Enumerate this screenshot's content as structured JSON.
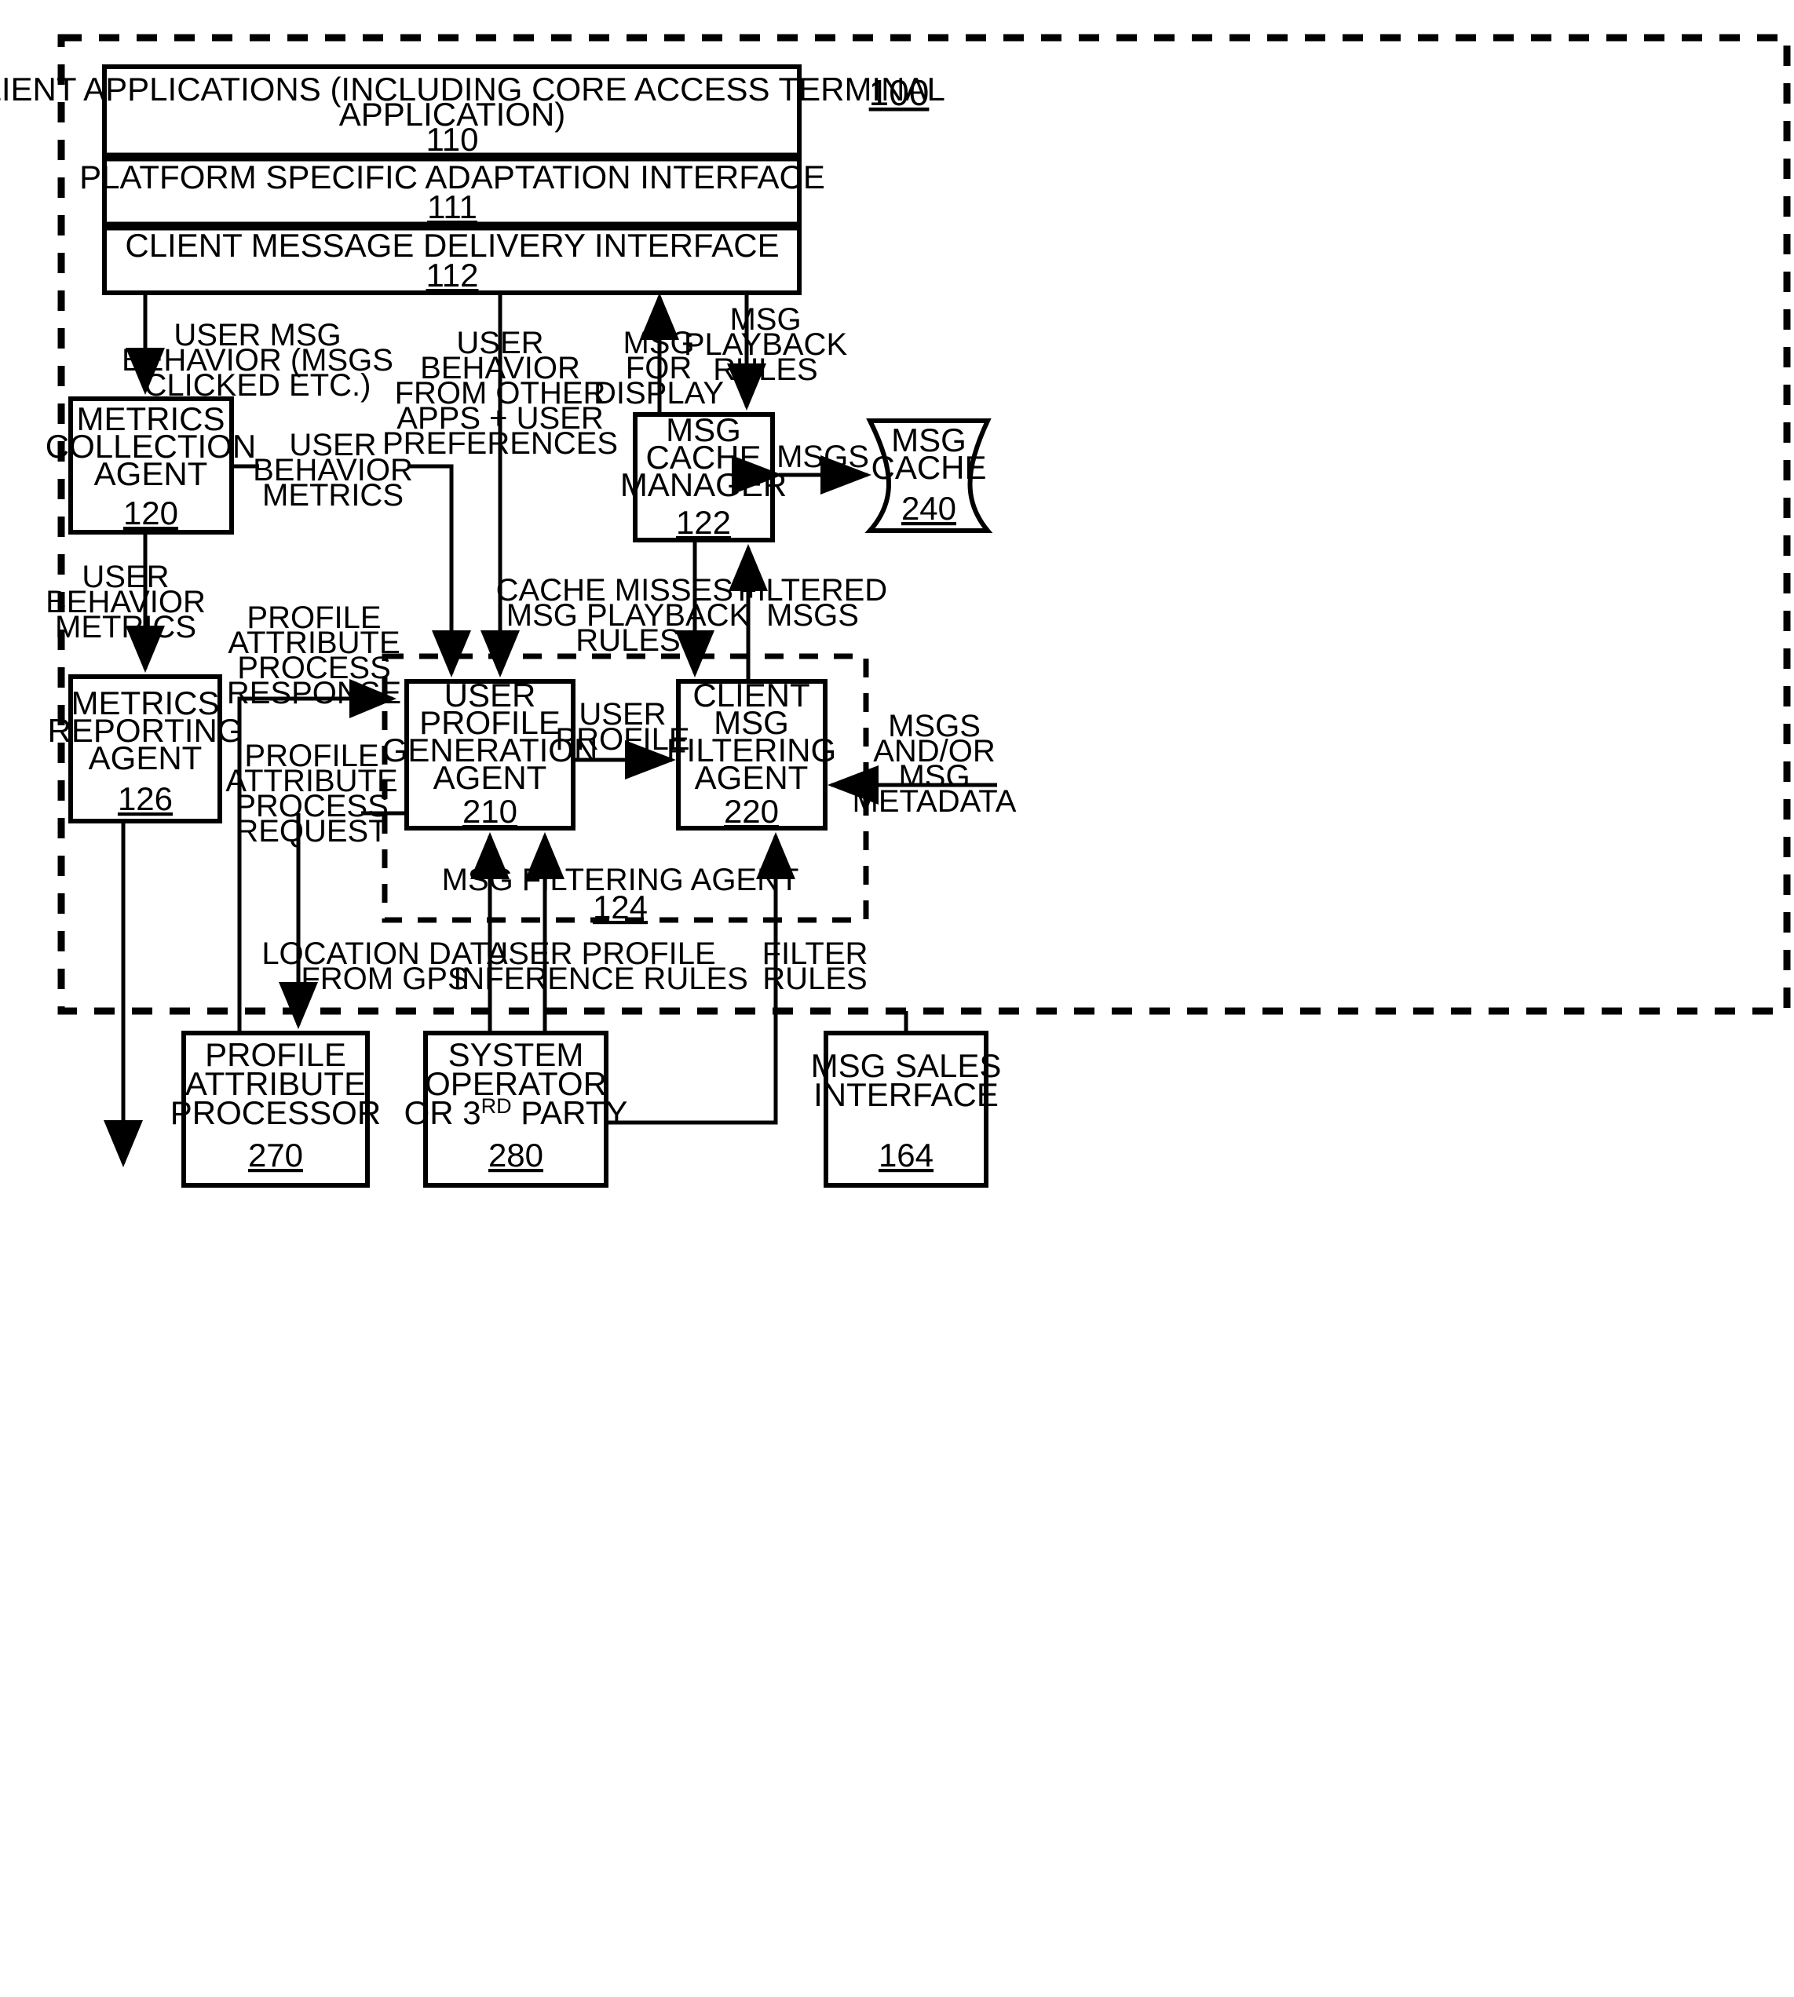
{
  "figure": {
    "reference_number": "100"
  },
  "stack": {
    "client_applications": {
      "line1": "CLIENT APPLICATIONS (INCLUDING CORE ACCESS TERMINAL",
      "line2": "APPLICATION)",
      "ref": "110"
    },
    "platform_interface": {
      "line1": "PLATFORM SPECIFIC ADAPTATION INTERFACE",
      "ref": "111"
    },
    "delivery_interface": {
      "line1": "CLIENT MESSAGE DELIVERY INTERFACE",
      "ref": "112"
    }
  },
  "boxes": {
    "metrics_collection_agent": {
      "lines": [
        "METRICS",
        "COLLECTION",
        "AGENT"
      ],
      "ref": "120"
    },
    "metrics_reporting_agent": {
      "lines": [
        "METRICS",
        "REPORTING",
        "AGENT"
      ],
      "ref": "126"
    },
    "msg_cache_manager": {
      "lines": [
        "MSG",
        "CACHE",
        "MANAGER"
      ],
      "ref": "122"
    },
    "msg_cache": {
      "lines": [
        "MSG",
        "CACHE"
      ],
      "ref": "240"
    },
    "user_profile_generation_agent": {
      "lines": [
        "USER",
        "PROFILE",
        "GENERATION",
        "AGENT"
      ],
      "ref": "210"
    },
    "client_msg_filtering_agent": {
      "lines": [
        "CLIENT",
        "MSG",
        "FILTERING",
        "AGENT"
      ],
      "ref": "220"
    },
    "msg_filtering_agent_group": {
      "label": "MSG FILTERING AGENT",
      "ref": "124"
    },
    "profile_attribute_processor": {
      "lines": [
        "PROFILE",
        "ATTRIBUTE",
        "PROCESSOR"
      ],
      "ref": "270"
    },
    "system_operator": {
      "line1": "SYSTEM",
      "line2": "OPERATOR",
      "line3_pre": "OR 3",
      "line3_sup": "RD",
      "line3_post": " PARTY",
      "ref": "280"
    },
    "msg_sales_interface": {
      "lines": [
        "MSG SALES",
        "INTERFACE"
      ],
      "ref": "164"
    }
  },
  "edge_labels": {
    "user_msg_behavior": [
      "USER MSG",
      "BEHAVIOR (MSGS",
      "CLICKED ETC.)"
    ],
    "user_behavior_other_apps": [
      "USER",
      "BEHAVIOR",
      "FROM OTHER",
      "APPS + USER",
      "PREFERENCES"
    ],
    "msg_for_display": [
      "MSG",
      "FOR",
      "DISPLAY"
    ],
    "msg_playback_rules": [
      "MSG",
      "PLAYBACK",
      "RULES"
    ],
    "user_behavior_metrics_right": [
      "USER",
      "BEHAVIOR",
      "METRICS"
    ],
    "msgs": [
      "MSGS"
    ],
    "user_behavior_metrics_down": [
      "USER",
      "BEHAVIOR",
      "METRICS"
    ],
    "profile_attribute_process_response": [
      "PROFILE",
      "ATTRIBUTE",
      "PROCESS",
      "RESPONSE"
    ],
    "profile_attribute_process_request": [
      "PROFILE",
      "ATTRIBUTE",
      "PROCESS",
      "REQUEST"
    ],
    "cache_misses": [
      "CACHE MISSES +",
      "MSG PLAYBACK",
      "RULES"
    ],
    "filtered_msgs": [
      "FILTERED",
      "MSGS"
    ],
    "user_profile": [
      "USER",
      "PROFILE"
    ],
    "msgs_andor_metadata": [
      "MSGS",
      "AND/OR",
      "MSG",
      "METADATA"
    ],
    "location_data": [
      "LOCATION DATA",
      "FROM GPS"
    ],
    "user_profile_inference_rules": [
      "USER PROFILE",
      "INFERENCE RULES"
    ],
    "filter_rules": [
      "FILTER",
      "RULES"
    ]
  }
}
